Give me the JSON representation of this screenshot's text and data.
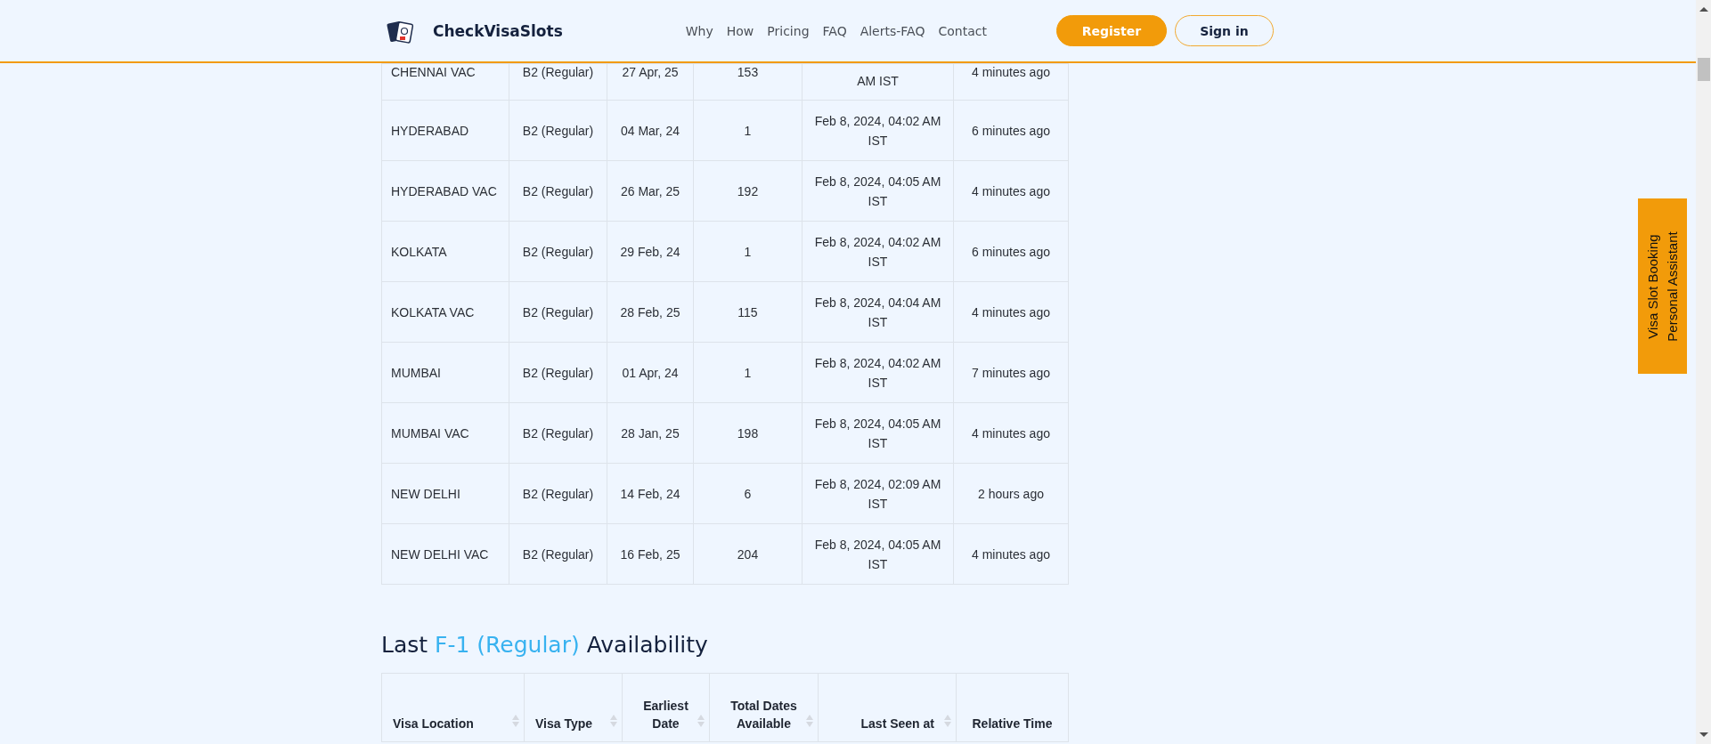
{
  "header": {
    "brand": "CheckVisaSlots",
    "nav": [
      "Why",
      "How",
      "Pricing",
      "FAQ",
      "Alerts-FAQ",
      "Contact"
    ],
    "buttons": [
      {
        "label": "Register",
        "kind": "primary"
      },
      {
        "label": "Sign in",
        "kind": "outline"
      }
    ]
  },
  "table_1": {
    "rows": [
      {
        "location": "CHENNAI VAC",
        "visa_type": "B2 (Regular)",
        "earliest_date": "27 Apr, 25",
        "total_dates": "153",
        "last_seen": "AM IST",
        "relative_time": "4 minutes ago",
        "cut": true
      },
      {
        "location": "HYDERABAD",
        "visa_type": "B2 (Regular)",
        "earliest_date": "04 Mar, 24",
        "total_dates": "1",
        "last_seen": "Feb 8, 2024, 04:02 AM IST",
        "relative_time": "6 minutes ago",
        "cut": false
      },
      {
        "location": "HYDERABAD VAC",
        "visa_type": "B2 (Regular)",
        "earliest_date": "26 Mar, 25",
        "total_dates": "192",
        "last_seen": "Feb 8, 2024, 04:05 AM IST",
        "relative_time": "4 minutes ago",
        "cut": false
      },
      {
        "location": "KOLKATA",
        "visa_type": "B2 (Regular)",
        "earliest_date": "29 Feb, 24",
        "total_dates": "1",
        "last_seen": "Feb 8, 2024, 04:02 AM IST",
        "relative_time": "6 minutes ago",
        "cut": false
      },
      {
        "location": "KOLKATA VAC",
        "visa_type": "B2 (Regular)",
        "earliest_date": "28 Feb, 25",
        "total_dates": "115",
        "last_seen": "Feb 8, 2024, 04:04 AM IST",
        "relative_time": "4 minutes ago",
        "cut": false
      },
      {
        "location": "MUMBAI",
        "visa_type": "B2 (Regular)",
        "earliest_date": "01 Apr, 24",
        "total_dates": "1",
        "last_seen": "Feb 8, 2024, 04:02 AM IST",
        "relative_time": "7 minutes ago",
        "cut": false
      },
      {
        "location": "MUMBAI VAC",
        "visa_type": "B2 (Regular)",
        "earliest_date": "28 Jan, 25",
        "total_dates": "198",
        "last_seen": "Feb 8, 2024, 04:05 AM IST",
        "relative_time": "4 minutes ago",
        "cut": false
      },
      {
        "location": "NEW DELHI",
        "visa_type": "B2 (Regular)",
        "earliest_date": "14 Feb, 24",
        "total_dates": "6",
        "last_seen": "Feb 8, 2024, 02:09 AM IST",
        "relative_time": "2 hours ago",
        "cut": false
      },
      {
        "location": "NEW DELHI VAC",
        "visa_type": "B2 (Regular)",
        "earliest_date": "16 Feb, 25",
        "total_dates": "204",
        "last_seen": "Feb 8, 2024, 04:05 AM IST",
        "relative_time": "4 minutes ago",
        "cut": false
      }
    ]
  },
  "section_heading": {
    "before": "Last",
    "highlight": "F-1 (Regular)",
    "after": "Availability"
  },
  "table_2": {
    "columns": [
      {
        "label": "Visa Location",
        "sortable": true
      },
      {
        "label": "Visa Type",
        "sortable": true
      },
      {
        "label": "Earliest Date",
        "sortable": true
      },
      {
        "label": "Total Dates Available",
        "sortable": true
      },
      {
        "label": "Last Seen at",
        "sortable": true
      },
      {
        "label": "Relative Time",
        "sortable": false
      }
    ]
  },
  "side_tab": {
    "lines": [
      "Visa Slot Booking",
      "Personal Assistant"
    ]
  }
}
